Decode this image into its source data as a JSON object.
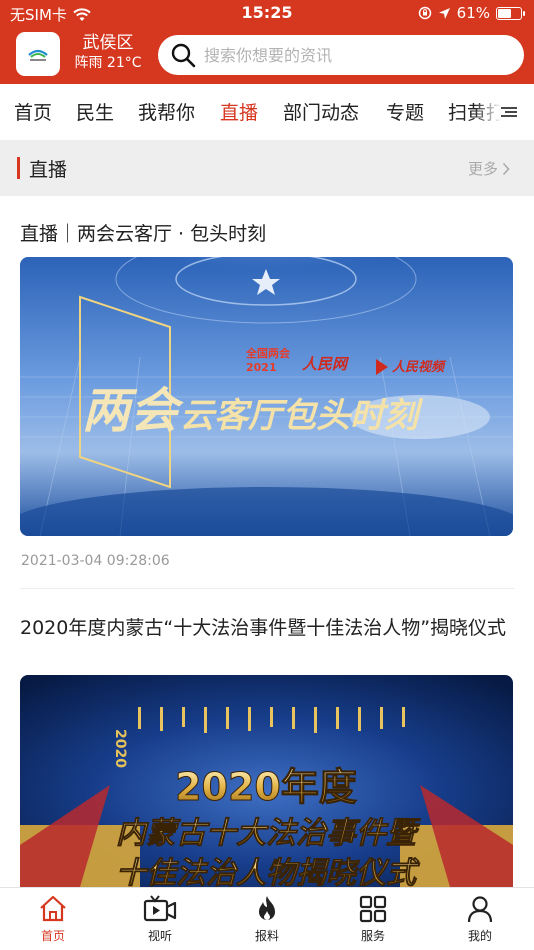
{
  "status_bar": {
    "carrier": "无SIM卡",
    "time": "15:25",
    "battery_percent": "61%",
    "battery_level": 0.61
  },
  "app_bar": {
    "city": "武侯区",
    "weather": "阵雨 21°C",
    "search_placeholder": "搜索你想要的资讯"
  },
  "channels": {
    "items": [
      "首页",
      "民生",
      "我帮你",
      "直播",
      "部门动态",
      "专题",
      "扫黄打"
    ],
    "active": "直播"
  },
  "section": {
    "title": "直播",
    "more_label": "更多"
  },
  "articles": [
    {
      "title": "直播｜两会云客厅 · 包头时刻",
      "date": "2021-03-04 09:28:06",
      "image_texts": {
        "main": "两会云客厅包头时刻",
        "badge": "全国两会",
        "badge_year": "2021",
        "media1": "人民网",
        "media2": "人民视频"
      }
    },
    {
      "title": "2020年度内蒙古“十大法治事件暨十佳法治人物”揭晓仪式",
      "image_texts": {
        "year_tag": "2020",
        "main": "2020年度",
        "sub": "内蒙古十大法治事件暨",
        "sub2": "十佳法治人物揭晓仪式"
      }
    }
  ],
  "tabbar": {
    "items": [
      "首页",
      "视听",
      "报料",
      "服务",
      "我的"
    ],
    "active": "首页"
  },
  "colors": {
    "brand": "#d6371f",
    "section_bg": "#eeeeee",
    "muted": "#999999"
  }
}
